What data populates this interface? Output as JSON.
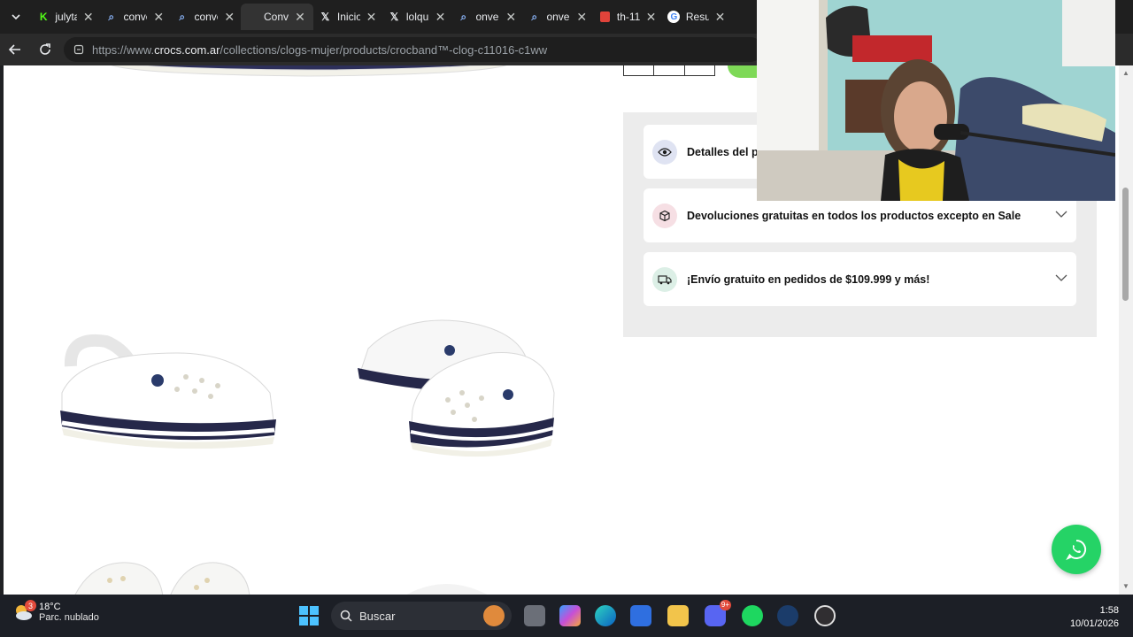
{
  "tabs": [
    {
      "label": "julyta",
      "icon": "kick-icon"
    },
    {
      "label": "conve",
      "icon": "search-icon"
    },
    {
      "label": "conve",
      "icon": "search-icon"
    },
    {
      "label": "Conv",
      "icon": "blank-icon"
    },
    {
      "label": "Inicio",
      "icon": "x-logo-icon"
    },
    {
      "label": "lolqu",
      "icon": "x-logo-icon"
    },
    {
      "label": "onve",
      "icon": "search-icon"
    },
    {
      "label": "onve",
      "icon": "search-icon"
    },
    {
      "label": "th-11",
      "icon": "shop-icon"
    },
    {
      "label": "Resul",
      "icon": "google-icon"
    }
  ],
  "address": {
    "prefix": "https://www.",
    "domain": "crocs.com.ar",
    "path": "/collections/clogs-mujer/products/crocband™-clog-c11016-c1ww"
  },
  "accordions": [
    {
      "label": "Detalles del p",
      "icon": "eye-icon",
      "color": "#dfe3f2"
    },
    {
      "label": "Devoluciones gratuitas en todos los productos excepto en Sale",
      "icon": "box-icon",
      "color": "#f6dfe4"
    },
    {
      "label": "¡Envío gratuito en pedidos de $109.999 y más!",
      "icon": "truck-icon",
      "color": "#dcefe6"
    }
  ],
  "taskbar": {
    "weather_badge": "3",
    "temperature": "18°C",
    "condition": "Parc. nublado",
    "search_placeholder": "Buscar",
    "discord_badge": "9+",
    "time": "1:58",
    "date": "10/01/2026"
  },
  "colors": {
    "whatsapp": "#25d366",
    "add_to_cart": "#7ed957",
    "panel_bg": "#ececec"
  }
}
